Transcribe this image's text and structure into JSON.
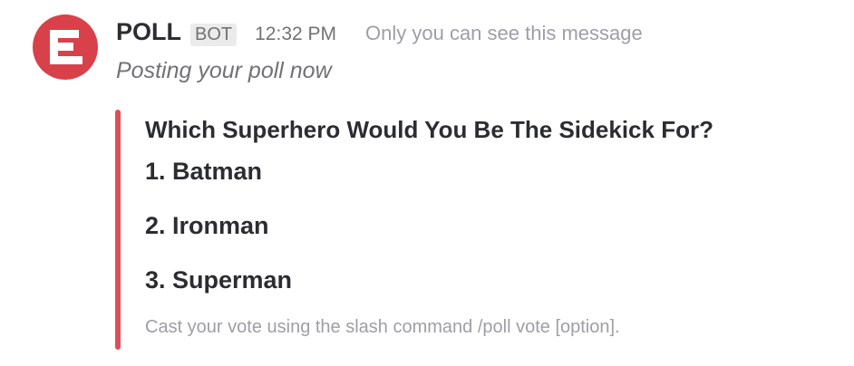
{
  "message": {
    "avatar_icon": "poll-bar-chart-icon",
    "avatar_color": "#d9414a",
    "sender": "POLL",
    "badge": "BOT",
    "timestamp": "12:32 PM",
    "visibility_note": "Only you can see this message",
    "text": "Posting your poll now"
  },
  "attachment": {
    "bar_color": "#d9505a",
    "question": "Which Superhero Would You Be The Sidekick For?",
    "options": [
      {
        "label": "1. Batman"
      },
      {
        "label": "2. Ironman"
      },
      {
        "label": "3. Superman"
      }
    ],
    "footer": "Cast your vote using the slash command /poll vote [option]."
  }
}
